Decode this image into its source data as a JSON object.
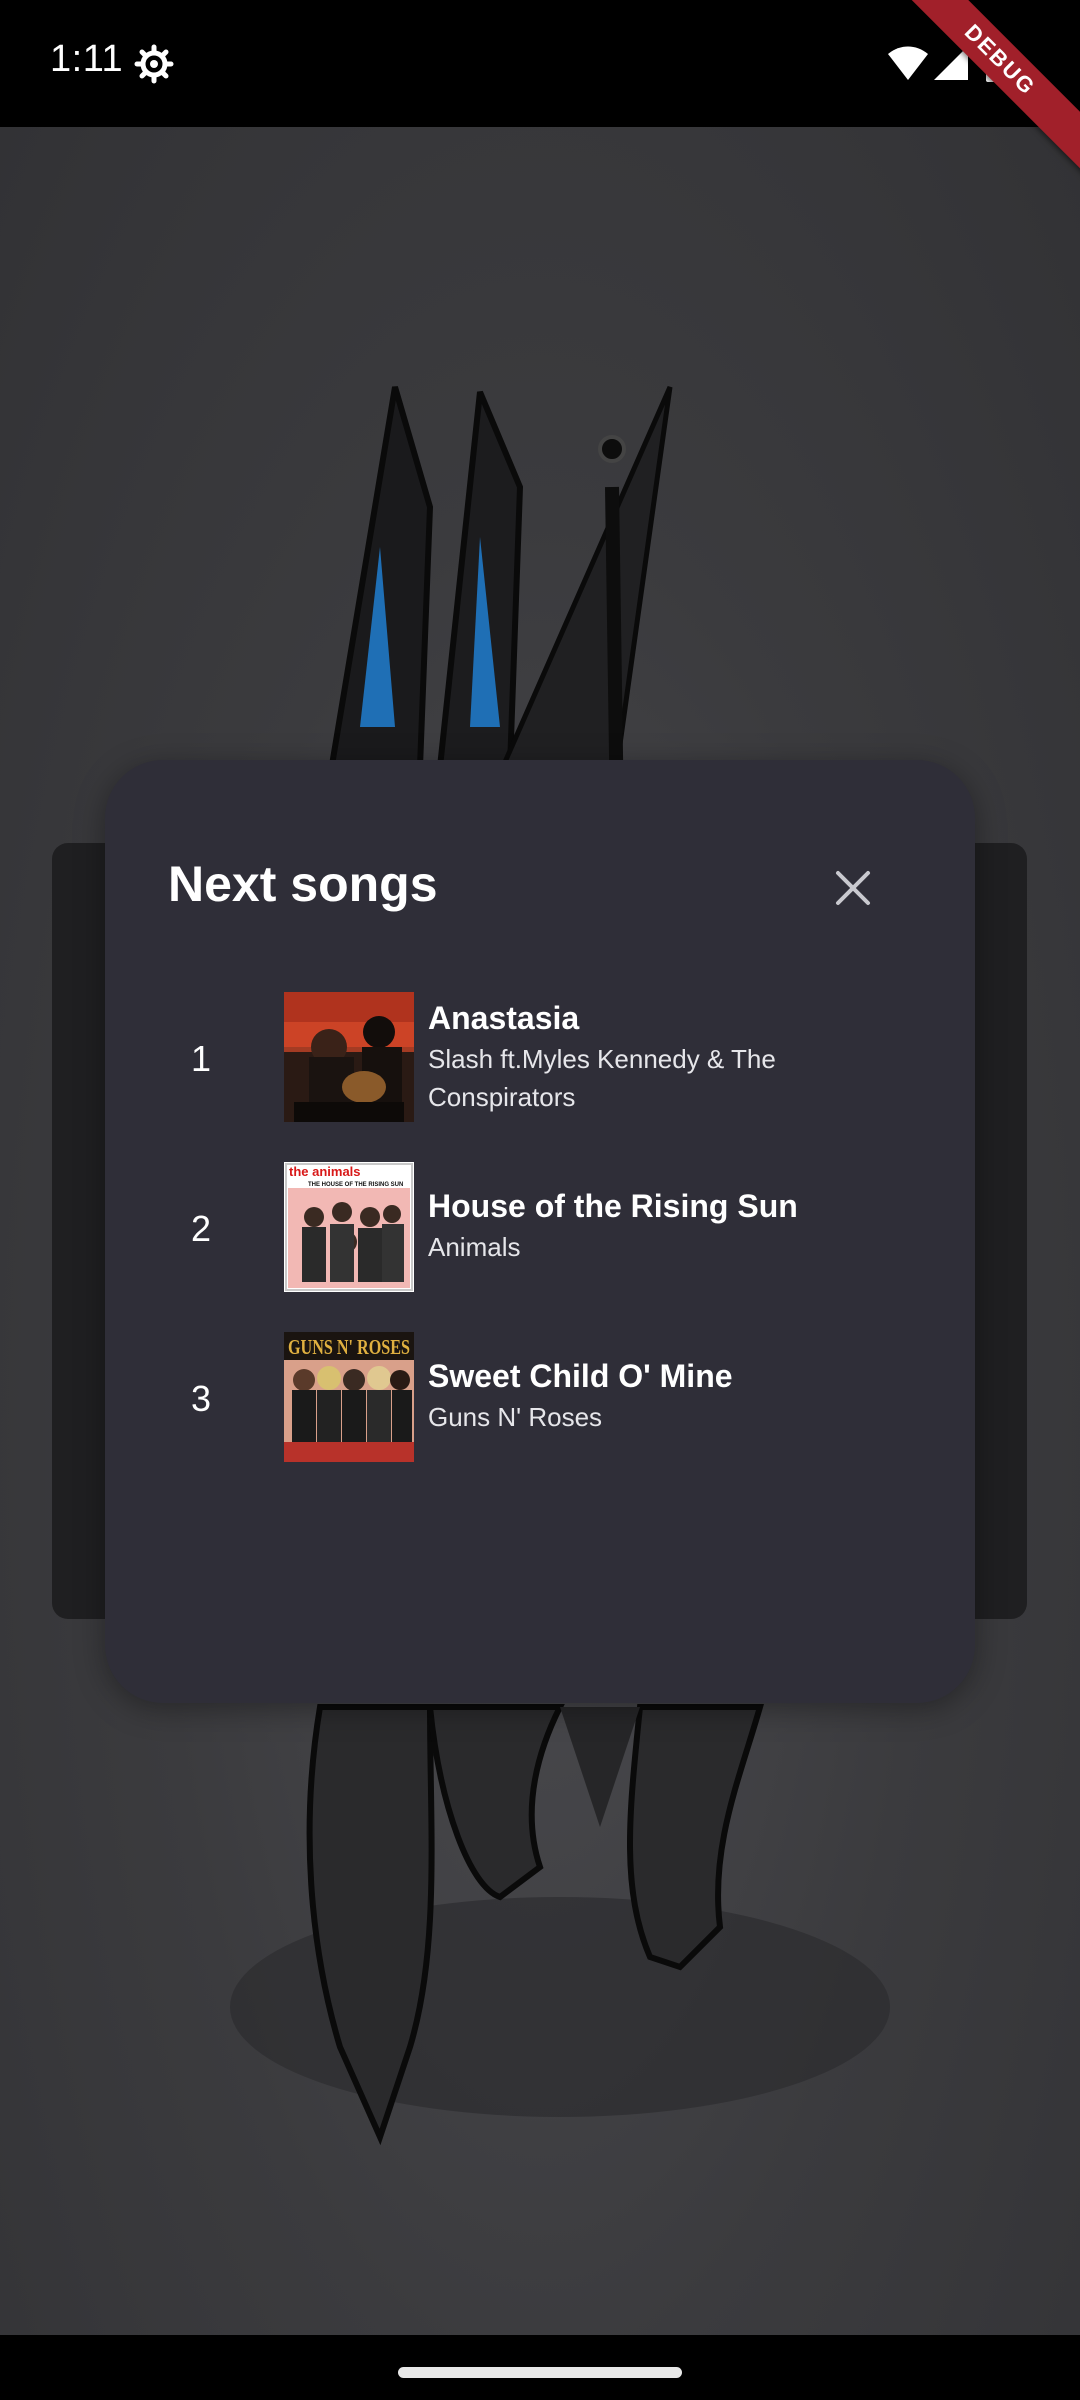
{
  "status_bar": {
    "time": "1:11",
    "debug_label": "DEBUG"
  },
  "dialog": {
    "title": "Next songs",
    "close_icon": "close-icon",
    "songs": [
      {
        "index": "1",
        "title": "Anastasia",
        "artist_line1": "Slash ft.Myles Kennedy & The",
        "artist_line2": "Conspirators"
      },
      {
        "index": "2",
        "title": "House of the Rising Sun",
        "artist_line1": "Animals",
        "artist_line2": ""
      },
      {
        "index": "3",
        "title": "Sweet Child O' Mine",
        "artist_line1": "Guns N' Roses",
        "artist_line2": ""
      }
    ],
    "album_art_texts": {
      "animals_top": "the animals",
      "animals_sub": "THE HOUSE OF THE RISING SUN",
      "gnr_top": "GUNS N' ROSES"
    }
  },
  "colors": {
    "dialog_bg": "#2f2e38",
    "page_bg": "#3a3a3d",
    "debug_ribbon": "#a1202a"
  }
}
